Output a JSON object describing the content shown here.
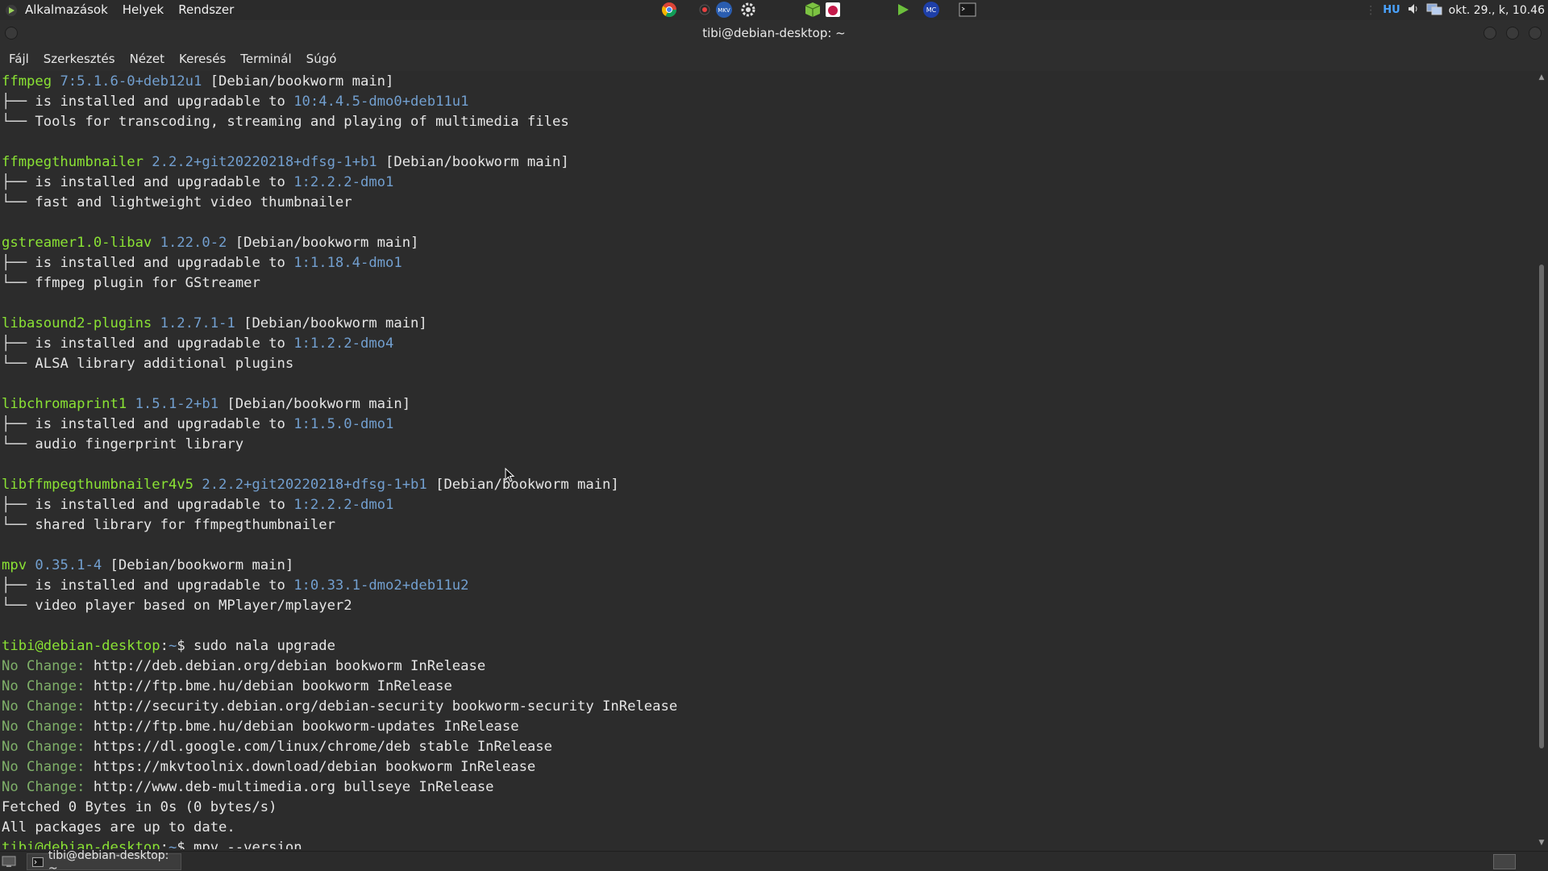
{
  "top_panel": {
    "menus": [
      "Alkalmazások",
      "Helyek",
      "Rendszer"
    ],
    "launchers": [
      "chrome-icon",
      "media-player-icon",
      "mkvtoolnix-icon",
      "settings-gear-icon",
      "package-cube-icon",
      "raspberry-app-icon",
      "run-arrow-icon",
      "mc-icon",
      "terminal-icon"
    ],
    "keyboard_layout": "HU",
    "clock": "okt. 29., k, 10.46"
  },
  "window": {
    "title": "tibi@debian-desktop: ~",
    "menus": [
      "Fájl",
      "Szerkesztés",
      "Nézet",
      "Keresés",
      "Terminál",
      "Súgó"
    ]
  },
  "terminal": {
    "lines": [
      [
        [
          "g",
          "ffmpeg"
        ],
        [
          "b",
          " 7:5.1.6-0+deb12u1"
        ],
        [
          "t",
          " [Debian/bookworm main]"
        ]
      ],
      [
        [
          "tree",
          "├── "
        ],
        [
          "t",
          "is installed and upgradable to "
        ],
        [
          "b",
          "10:4.4.5-dmo0+deb11u1"
        ]
      ],
      [
        [
          "tree",
          "└── "
        ],
        [
          "t",
          "Tools for transcoding, streaming and playing of multimedia files"
        ]
      ],
      [],
      [
        [
          "g",
          "ffmpegthumbnailer"
        ],
        [
          "b",
          " 2.2.2+git20220218+dfsg-1+b1"
        ],
        [
          "t",
          " [Debian/bookworm main]"
        ]
      ],
      [
        [
          "tree",
          "├── "
        ],
        [
          "t",
          "is installed and upgradable to "
        ],
        [
          "b",
          "1:2.2.2-dmo1"
        ]
      ],
      [
        [
          "tree",
          "└── "
        ],
        [
          "t",
          "fast and lightweight video thumbnailer"
        ]
      ],
      [],
      [
        [
          "g",
          "gstreamer1.0-libav"
        ],
        [
          "b",
          " 1.22.0-2"
        ],
        [
          "t",
          " [Debian/bookworm main]"
        ]
      ],
      [
        [
          "tree",
          "├── "
        ],
        [
          "t",
          "is installed and upgradable to "
        ],
        [
          "b",
          "1:1.18.4-dmo1"
        ]
      ],
      [
        [
          "tree",
          "└── "
        ],
        [
          "t",
          "ffmpeg plugin for GStreamer"
        ]
      ],
      [],
      [
        [
          "g",
          "libasound2-plugins"
        ],
        [
          "b",
          " 1.2.7.1-1"
        ],
        [
          "t",
          " [Debian/bookworm main]"
        ]
      ],
      [
        [
          "tree",
          "├── "
        ],
        [
          "t",
          "is installed and upgradable to "
        ],
        [
          "b",
          "1:1.2.2-dmo4"
        ]
      ],
      [
        [
          "tree",
          "└── "
        ],
        [
          "t",
          "ALSA library additional plugins"
        ]
      ],
      [],
      [
        [
          "g",
          "libchromaprint1"
        ],
        [
          "b",
          " 1.5.1-2+b1"
        ],
        [
          "t",
          " [Debian/bookworm main]"
        ]
      ],
      [
        [
          "tree",
          "├── "
        ],
        [
          "t",
          "is installed and upgradable to "
        ],
        [
          "b",
          "1:1.5.0-dmo1"
        ]
      ],
      [
        [
          "tree",
          "└── "
        ],
        [
          "t",
          "audio fingerprint library"
        ]
      ],
      [],
      [
        [
          "g",
          "libffmpegthumbnailer4v5"
        ],
        [
          "b",
          " 2.2.2+git20220218+dfsg-1+b1"
        ],
        [
          "t",
          " [Debian/bookworm main]"
        ]
      ],
      [
        [
          "tree",
          "├── "
        ],
        [
          "t",
          "is installed and upgradable to "
        ],
        [
          "b",
          "1:2.2.2-dmo1"
        ]
      ],
      [
        [
          "tree",
          "└── "
        ],
        [
          "t",
          "shared library for ffmpegthumbnailer"
        ]
      ],
      [],
      [
        [
          "g",
          "mpv"
        ],
        [
          "b",
          " 0.35.1-4"
        ],
        [
          "t",
          " [Debian/bookworm main]"
        ]
      ],
      [
        [
          "tree",
          "├── "
        ],
        [
          "t",
          "is installed and upgradable to "
        ],
        [
          "b",
          "1:0.33.1-dmo2+deb11u2"
        ]
      ],
      [
        [
          "tree",
          "└── "
        ],
        [
          "t",
          "video player based on MPlayer/mplayer2"
        ]
      ],
      [],
      [
        [
          "g",
          "tibi@debian-desktop"
        ],
        [
          "t",
          ":"
        ],
        [
          "b",
          "~"
        ],
        [
          "t",
          "$ sudo nala upgrade"
        ]
      ],
      [
        [
          "gr",
          "No Change:"
        ],
        [
          "t",
          " http://deb.debian.org/debian bookworm InRelease"
        ]
      ],
      [
        [
          "gr",
          "No Change:"
        ],
        [
          "t",
          " http://ftp.bme.hu/debian bookworm InRelease"
        ]
      ],
      [
        [
          "gr",
          "No Change:"
        ],
        [
          "t",
          " http://security.debian.org/debian-security bookworm-security InRelease"
        ]
      ],
      [
        [
          "gr",
          "No Change:"
        ],
        [
          "t",
          " http://ftp.bme.hu/debian bookworm-updates InRelease"
        ]
      ],
      [
        [
          "gr",
          "No Change:"
        ],
        [
          "t",
          " https://dl.google.com/linux/chrome/deb stable InRelease"
        ]
      ],
      [
        [
          "gr",
          "No Change:"
        ],
        [
          "t",
          " https://mkvtoolnix.download/debian bookworm InRelease"
        ]
      ],
      [
        [
          "gr",
          "No Change:"
        ],
        [
          "t",
          " http://www.deb-multimedia.org bullseye InRelease"
        ]
      ],
      [
        [
          "t",
          "Fetched 0 Bytes in 0s (0 bytes/s)"
        ]
      ],
      [
        [
          "t",
          "All packages are up to date."
        ]
      ],
      [
        [
          "g",
          "tibi@debian-desktop"
        ],
        [
          "t",
          ":"
        ],
        [
          "b",
          "~"
        ],
        [
          "t",
          "$ mpv --version"
        ]
      ]
    ]
  },
  "bottom_panel": {
    "task_label": "tibi@debian-desktop: ~"
  }
}
